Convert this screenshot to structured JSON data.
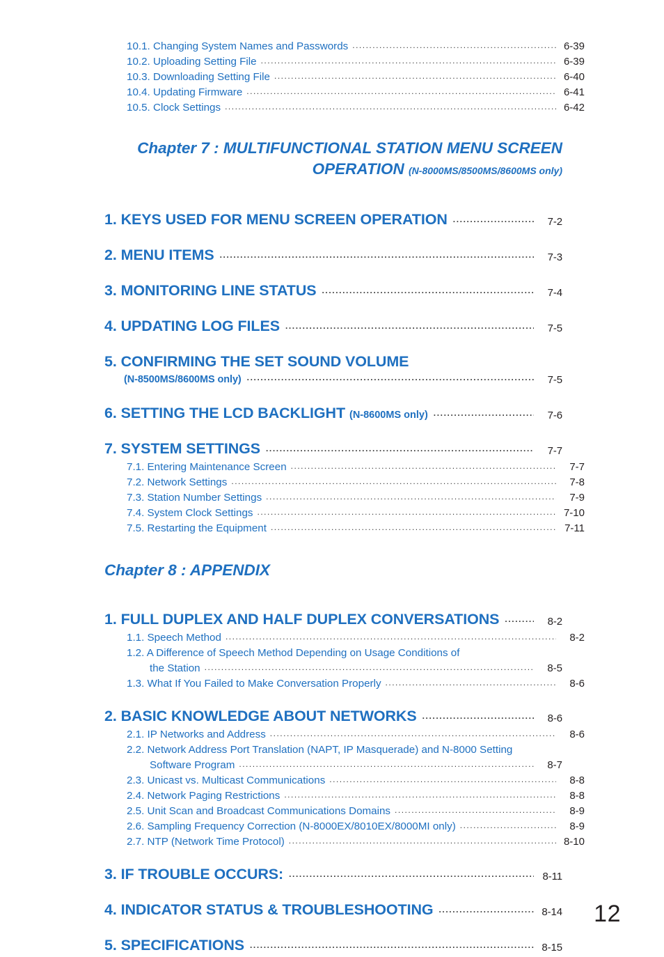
{
  "page": {
    "folio": "12",
    "accent_color": "#1f70c0",
    "page_number_color": "#231f20"
  },
  "top_subentries": [
    {
      "label": "10.1. Changing System Names and Passwords",
      "page": "6-39"
    },
    {
      "label": "10.2. Uploading Setting File",
      "page": "6-39"
    },
    {
      "label": "10.3. Downloading Setting File",
      "page": "6-40"
    },
    {
      "label": "10.4. Updating Firmware",
      "page": "6-41"
    },
    {
      "label": "10.5. Clock Settings",
      "page": "6-42"
    }
  ],
  "chapter7": {
    "line1": "Chapter 7 : MULTIFUNCTIONAL STATION MENU SCREEN",
    "line2": "OPERATION",
    "line2_note": "(N-8000MS/8500MS/8600MS only)",
    "sections": [
      {
        "label": "1. KEYS USED FOR MENU SCREEN OPERATION",
        "page": "7-2"
      },
      {
        "label": "2. MENU ITEMS",
        "page": "7-3"
      },
      {
        "label": "3. MONITORING LINE STATUS",
        "page": "7-4"
      },
      {
        "label": "4. UPDATING LOG FILES",
        "page": "7-5"
      },
      {
        "label": "5. CONFIRMING THE SET SOUND VOLUME",
        "note": "(N-8500MS/8600MS only)",
        "page": "7-5"
      },
      {
        "label": "6. SETTING THE LCD BACKLIGHT",
        "note_inline": "(N-8600MS only)",
        "page": "7-6"
      },
      {
        "label": "7. SYSTEM SETTINGS",
        "page": "7-7"
      }
    ],
    "section7_subentries": [
      {
        "label": "7.1. Entering Maintenance Screen",
        "page": "7-7"
      },
      {
        "label": "7.2. Network Settings",
        "page": "7-8"
      },
      {
        "label": "7.3. Station Number Settings",
        "page": "7-9"
      },
      {
        "label": "7.4. System Clock Settings",
        "page": "7-10"
      },
      {
        "label": "7.5. Restarting the Equipment",
        "page": "7-11"
      }
    ]
  },
  "chapter8": {
    "title": "Chapter 8 : APPENDIX",
    "section1": {
      "label": "1. FULL DUPLEX AND HALF DUPLEX CONVERSATIONS",
      "page": "8-2"
    },
    "section1_subentries": [
      {
        "label": "1.1. Speech Method",
        "page": "8-2"
      },
      {
        "label_line1": "1.2. A Difference of Speech Method Depending on Usage Conditions of",
        "label_line2": "the Station",
        "page": "8-5"
      },
      {
        "label": "1.3. What If You Failed to Make Conversation Properly",
        "page": "8-6"
      }
    ],
    "section2": {
      "label": "2. BASIC KNOWLEDGE ABOUT NETWORKS",
      "page": "8-6"
    },
    "section2_subentries": [
      {
        "label": "2.1. IP Networks and Address",
        "page": "8-6"
      },
      {
        "label_line1": "2.2. Network Address Port Translation (NAPT, IP Masquerade) and N-8000 Setting",
        "label_line2": "Software Program",
        "page": "8-7"
      },
      {
        "label": "2.3. Unicast vs. Multicast Communications",
        "page": "8-8"
      },
      {
        "label": "2.4. Network Paging Restrictions",
        "page": "8-8"
      },
      {
        "label": "2.5. Unit Scan and Broadcast Communications Domains",
        "page": "8-9"
      },
      {
        "label": "2.6. Sampling Frequency Correction (N-8000EX/8010EX/8000MI only)",
        "page": "8-9"
      },
      {
        "label": "2.7. NTP (Network Time Protocol)",
        "page": "8-10"
      }
    ],
    "sections_tail": [
      {
        "label": "3. IF TROUBLE OCCURS:",
        "page": "8-11"
      },
      {
        "label": "4. INDICATOR STATUS & TROUBLESHOOTING",
        "page": "8-14"
      },
      {
        "label": "5. SPECIFICATIONS",
        "page": "8-15"
      }
    ]
  }
}
